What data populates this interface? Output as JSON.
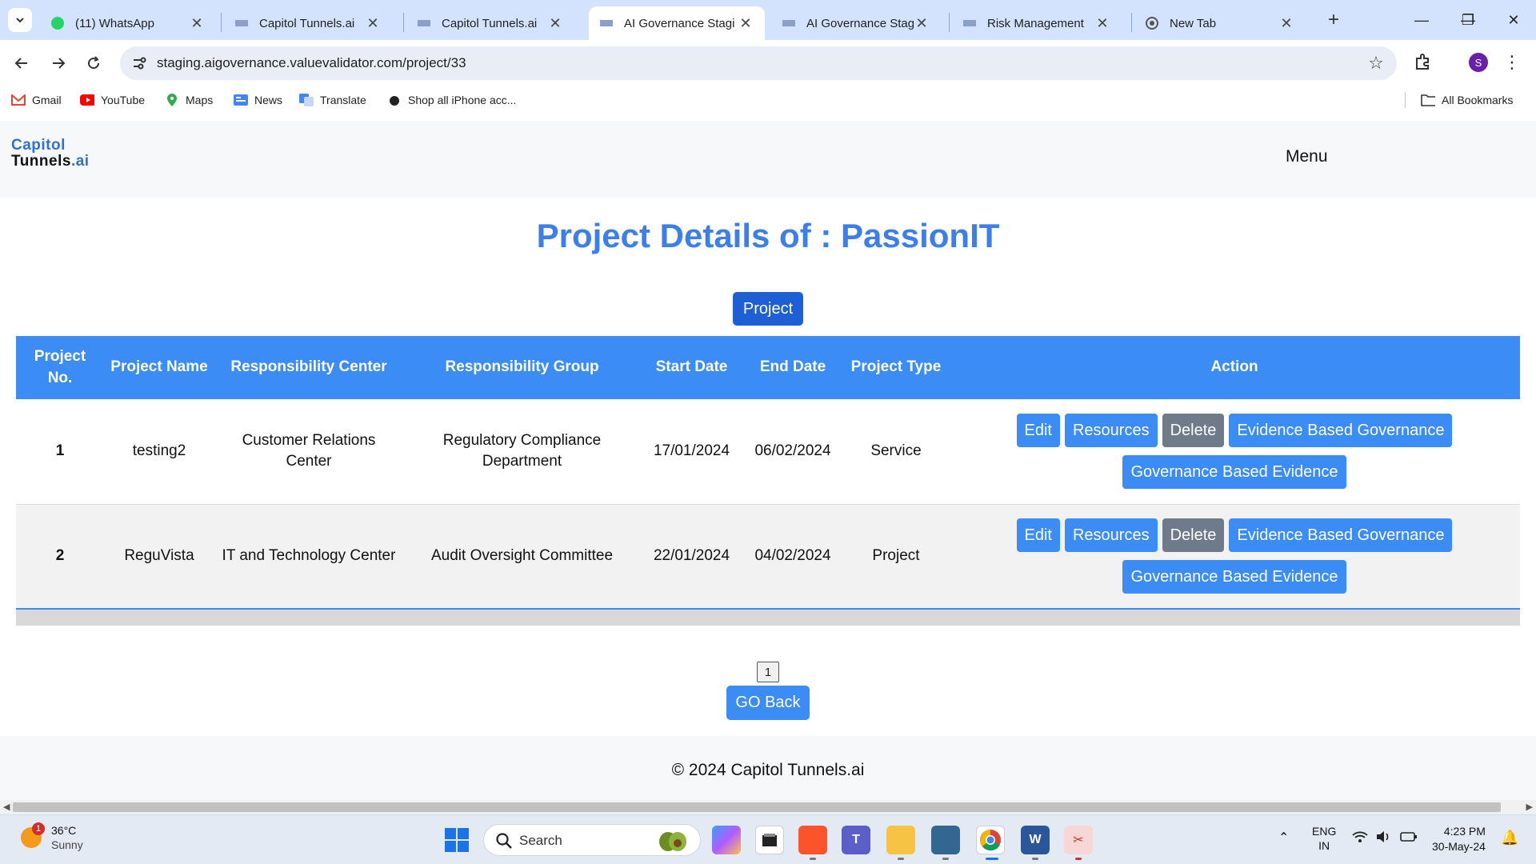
{
  "browser": {
    "tabs": [
      {
        "title": "(11) WhatsApp",
        "icon": "whatsapp-icon"
      },
      {
        "title": "Capitol Tunnels.ai",
        "icon": "site-logo-icon"
      },
      {
        "title": "Capitol Tunnels.ai",
        "icon": "site-logo-icon"
      },
      {
        "title": "AI Governance Stagi",
        "icon": "site-logo-icon",
        "active": true
      },
      {
        "title": "AI Governance Stagi",
        "icon": "site-logo-icon"
      },
      {
        "title": "Risk Management",
        "icon": "site-logo-icon"
      },
      {
        "title": "New Tab",
        "icon": "chrome-icon"
      }
    ],
    "url": "staging.aigovernance.valuevalidator.com/project/33",
    "profile_initial": "S",
    "bookmarks": [
      {
        "label": "Gmail",
        "icon": "gmail-icon"
      },
      {
        "label": "YouTube",
        "icon": "youtube-icon"
      },
      {
        "label": "Maps",
        "icon": "maps-icon"
      },
      {
        "label": "News",
        "icon": "news-icon"
      },
      {
        "label": "Translate",
        "icon": "translate-icon"
      },
      {
        "label": "Shop all iPhone acc...",
        "icon": "apple-icon"
      }
    ],
    "all_bookmarks": "All Bookmarks"
  },
  "site": {
    "logo_line1": "Capitol",
    "logo_line2": "Tunnels",
    "logo_suffix": ".ai",
    "menu": "Menu"
  },
  "page": {
    "title": "Project Details of : PassionIT",
    "project_button": "Project",
    "columns": [
      "Project No.",
      "Project Name",
      "Responsibility Center",
      "Responsibility Group",
      "Start Date",
      "End Date",
      "Project Type",
      "Action"
    ],
    "rows": [
      {
        "no": "1",
        "name": "testing2",
        "center": "Customer Relations Center",
        "group": "Regulatory Compliance Department",
        "start": "17/01/2024",
        "end": "06/02/2024",
        "type": "Service"
      },
      {
        "no": "2",
        "name": "ReguVista",
        "center": "IT and Technology Center",
        "group": "Audit Oversight Committee",
        "start": "22/01/2024",
        "end": "04/02/2024",
        "type": "Project"
      }
    ],
    "actions": {
      "edit": "Edit",
      "resources": "Resources",
      "delete": "Delete",
      "ebg": "Evidence Based Governance",
      "gbe": "Governance Based Evidence"
    },
    "page_number": "1",
    "go_back": "GO Back",
    "footer": "© 2024 Capitol Tunnels.ai"
  },
  "taskbar": {
    "weather_temp": "36°C",
    "weather_desc": "Sunny",
    "weather_badge": "1",
    "search": "Search",
    "lang1": "ENG",
    "lang2": "IN",
    "time": "4:23 PM",
    "date": "30-May-24"
  },
  "colors": {
    "primary": "#3b8cf5",
    "title": "#3c7fe8",
    "delete": "#6f7b8b"
  }
}
